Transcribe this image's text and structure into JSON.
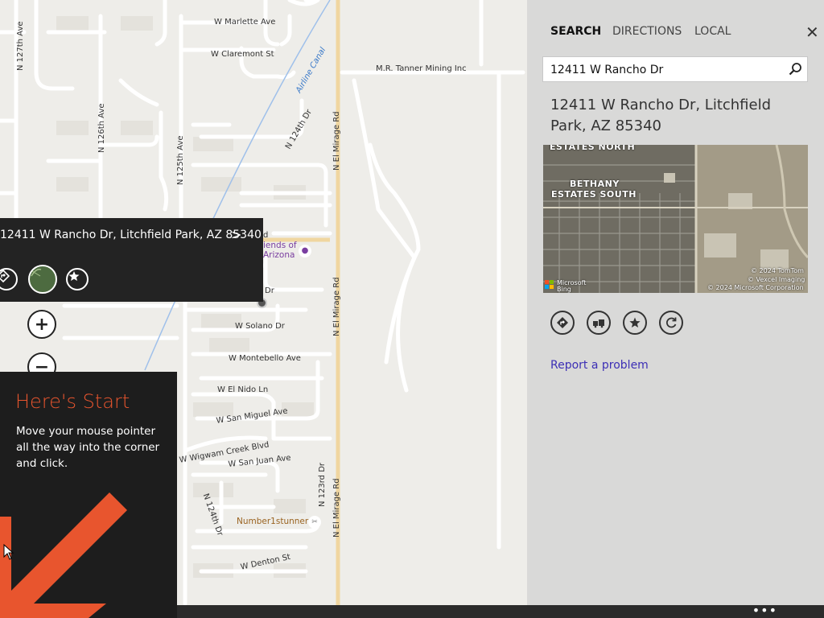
{
  "map": {
    "street_labels": [
      "W Marlette Ave",
      "W Claremont St",
      "Airline Canal",
      "N 127th Ave",
      "N 126th Ave",
      "N 125th Ave",
      "N 124th Dr",
      "N El Mirage Rd",
      "M.R. Tanner Mining Inc",
      "W Solano Dr",
      "W Montebello Ave",
      "W El Nido Ln",
      "W San Miguel Ave",
      "W Wigwam Creek Blvd",
      "W San Juan Ave",
      "N 124th Dr",
      "N 123rd Dr",
      "W Denton St",
      "Dr",
      "d"
    ],
    "poi_label": "iends of\nArizona",
    "poi2_label": "Number1stunner",
    "callout": {
      "address": "12411 W Rancho Dr, Litchfield Park, AZ 85340",
      "chevron": ">"
    },
    "zoom_in": "+",
    "zoom_out": "−"
  },
  "tip": {
    "title": "Here's Start",
    "body": "Move your mouse pointer all the way into the corner and click.",
    "accent": "#e8552e"
  },
  "bottom_bar": {
    "more": "•••"
  },
  "panel": {
    "tabs": [
      "SEARCH",
      "DIRECTIONS",
      "LOCAL"
    ],
    "close": "✕",
    "search": {
      "value": "12411 W Rancho Dr"
    },
    "result_address": "12411 W Rancho Dr, Litchfield Park, AZ 85340",
    "aerial": {
      "labels": [
        "ESTATES NORTH",
        "BETHANY",
        "ESTATES SOUTH"
      ],
      "credit_1": "© 2024 TomTom",
      "credit_2": "© Vexcel Imaging",
      "credit_3": "© 2024 Microsoft Corporation",
      "brand_1": "Microsoft",
      "brand_2": "Bing"
    },
    "actions": [
      "directions-icon",
      "traffic-icon",
      "favorite-icon",
      "refresh-icon"
    ],
    "report": "Report a problem"
  }
}
